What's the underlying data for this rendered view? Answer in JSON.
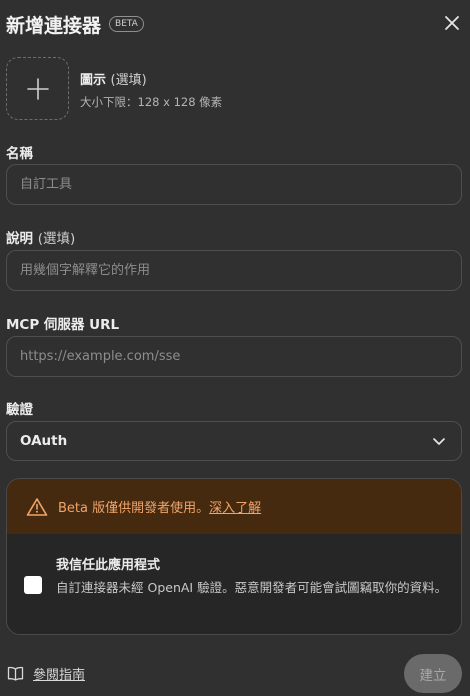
{
  "header": {
    "title": "新增連接器",
    "badge": "BETA"
  },
  "icon_upload": {
    "label": "圖示",
    "optional": "(選填)",
    "hint": "大小下限：128 x 128 像素"
  },
  "name_field": {
    "label": "名稱",
    "placeholder": "自訂工具",
    "value": ""
  },
  "description_field": {
    "label": "說明",
    "optional": "(選填)",
    "placeholder": "用幾個字解釋它的作用",
    "value": ""
  },
  "url_field": {
    "label": "MCP 伺服器 URL",
    "placeholder": "https://example.com/sse",
    "value": ""
  },
  "auth_field": {
    "label": "驗證",
    "selected": "OAuth"
  },
  "warning": {
    "text": "Beta 版僅供開發者使用。",
    "link": "深入了解",
    "color": "#f0a46a",
    "background": "#462a10"
  },
  "trust": {
    "title": "我信任此應用程式",
    "description": "自訂連接器未經 OpenAI 驗證。惡意開發者可能會試圖竊取你的資料。",
    "checked": false
  },
  "footer": {
    "guide_link": "參閱指南",
    "create_button": "建立"
  },
  "icons": {
    "close": "close-icon",
    "plus": "plus-icon",
    "chevron": "chevron-down-icon",
    "warning": "warning-triangle-icon",
    "guide": "book-icon"
  }
}
